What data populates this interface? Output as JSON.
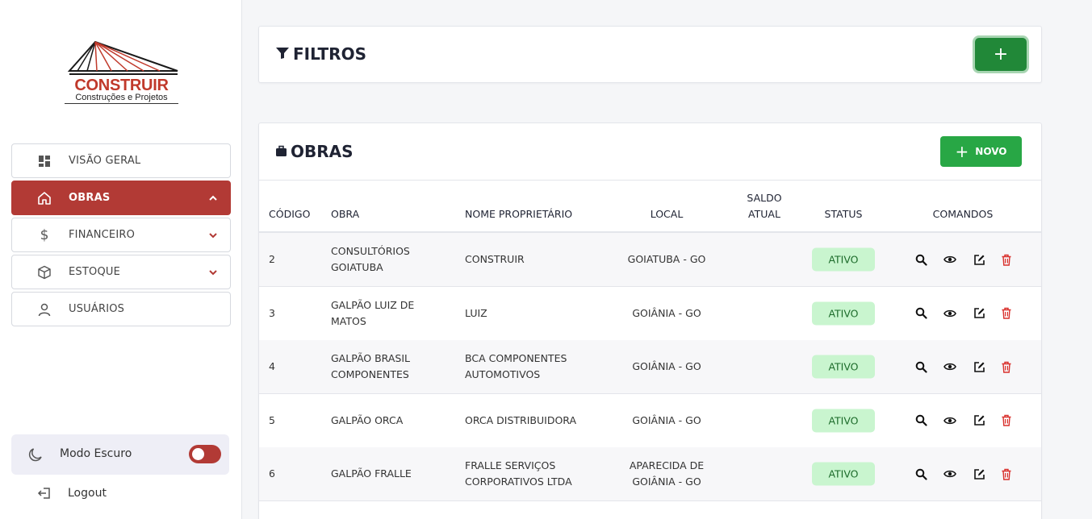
{
  "brand": {
    "title": "CONSTRUIR",
    "subtitle": "Construções e Projetos",
    "color": "#c0392b"
  },
  "sidebar": {
    "items": [
      {
        "label": "VISÃO GERAL",
        "icon": "dashboard-icon",
        "active": false,
        "chevron": null
      },
      {
        "label": "OBRAS",
        "icon": "home-icon",
        "active": true,
        "chevron": "chevron-up-icon"
      },
      {
        "label": "FINANCEIRO",
        "icon": "dollar-icon",
        "active": false,
        "chevron": "chevron-down-icon"
      },
      {
        "label": "ESTOQUE",
        "icon": "box-icon",
        "active": false,
        "chevron": "chevron-down-icon"
      },
      {
        "label": "USUÁRIOS",
        "icon": "user-icon",
        "active": false,
        "chevron": null
      }
    ],
    "dark_mode": {
      "label": "Modo Escuro",
      "icon": "moon-icon",
      "enabled": true
    },
    "logout": {
      "label": "Logout",
      "icon": "logout-icon"
    }
  },
  "filters": {
    "title": "FILTROS",
    "icon": "filter-icon",
    "add_label": "+"
  },
  "obras": {
    "title": "OBRAS",
    "icon": "briefcase-icon",
    "new_button": {
      "plus": "+",
      "label": "NOVO"
    },
    "columns": {
      "codigo": "CÓDIGO",
      "obra": "OBRA",
      "proprietario": "NOME PROPRIETÁRIO",
      "local": "LOCAL",
      "saldo_1": "SALDO",
      "saldo_2": "ATUAL",
      "status": "STATUS",
      "comandos": "COMANDOS"
    },
    "rows": [
      {
        "codigo": "2",
        "obra_1": "CONSULTÓRIOS",
        "obra_2": "GOIATUBA",
        "prop_1": "CONSTRUIR",
        "prop_2": "",
        "local_1": "GOIATUBA - GO",
        "local_2": "",
        "saldo": "",
        "status": "ATIVO"
      },
      {
        "codigo": "3",
        "obra_1": "GALPÃO LUIZ DE",
        "obra_2": "MATOS",
        "prop_1": "LUIZ",
        "prop_2": "",
        "local_1": "GOIÂNIA - GO",
        "local_2": "",
        "saldo": "",
        "status": "ATIVO"
      },
      {
        "codigo": "4",
        "obra_1": "GALPÃO BRASIL",
        "obra_2": "COMPONENTES",
        "prop_1": "BCA COMPONENTES",
        "prop_2": "AUTOMOTIVOS",
        "local_1": "GOIÂNIA - GO",
        "local_2": "",
        "saldo": "",
        "status": "ATIVO"
      },
      {
        "codigo": "5",
        "obra_1": "GALPÃO ORCA",
        "obra_2": "",
        "prop_1": "ORCA DISTRIBUIDORA",
        "prop_2": "",
        "local_1": "GOIÂNIA - GO",
        "local_2": "",
        "saldo": "",
        "status": "ATIVO"
      },
      {
        "codigo": "6",
        "obra_1": "GALPÃO FRALLE",
        "obra_2": "",
        "prop_1": "FRALLE SERVIÇOS",
        "prop_2": "CORPORATIVOS LTDA",
        "local_1": "APARECIDA DE",
        "local_2": "GOIÂNIA - GO",
        "saldo": "",
        "status": "ATIVO"
      }
    ],
    "commands": [
      "search-icon",
      "eye-icon",
      "edit-icon",
      "trash-icon"
    ]
  },
  "colors": {
    "primary_red": "#b23a35",
    "success_green": "#28a745",
    "badge_bg": "#c9f5cf"
  }
}
